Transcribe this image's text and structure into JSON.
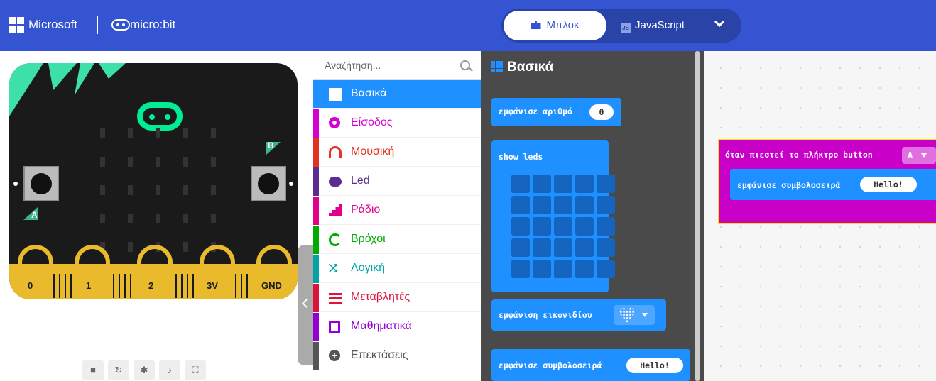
{
  "header": {
    "brand": "Microsoft",
    "product": "micro:bit",
    "tabs": {
      "blocks": "Μπλοκ",
      "javascript": "JavaScript",
      "js_badge": "JS"
    }
  },
  "simulator": {
    "buttons": {
      "a": "A",
      "b": "B"
    },
    "pins": [
      "0",
      "1",
      "2",
      "3V",
      "GND"
    ]
  },
  "toolbox": {
    "search_placeholder": "Αναζήτηση...",
    "categories": [
      {
        "label": "Βασικά",
        "color": "#1e90ff"
      },
      {
        "label": "Είσοδος",
        "color": "#d400d4"
      },
      {
        "label": "Μουσική",
        "color": "#e63022"
      },
      {
        "label": "Led",
        "color": "#5c2d91"
      },
      {
        "label": "Ράδιο",
        "color": "#e3008c"
      },
      {
        "label": "Βρόχοι",
        "color": "#00aa00"
      },
      {
        "label": "Λογική",
        "color": "#00a4a6"
      },
      {
        "label": "Μεταβλητές",
        "color": "#dc143c"
      },
      {
        "label": "Μαθηματικά",
        "color": "#9400d3"
      },
      {
        "label": "Επεκτάσεις",
        "color": "#555555"
      }
    ]
  },
  "flyout": {
    "title": "Βασικά",
    "blocks": {
      "show_number": "εμφάνισε αριθμό",
      "show_number_value": "0",
      "show_leds": "show leds",
      "show_icon": "εμφάνιση εικονιδίου",
      "show_string": "εμφάνισε συμβολοσειρά",
      "show_string_value": "Hello!"
    }
  },
  "workspace": {
    "event_label": "όταν πιεστεί το πλήκτρο button",
    "event_button": "A",
    "inner_label": "εμφάνισε συμβολοσειρά",
    "inner_value": "Hello!"
  }
}
